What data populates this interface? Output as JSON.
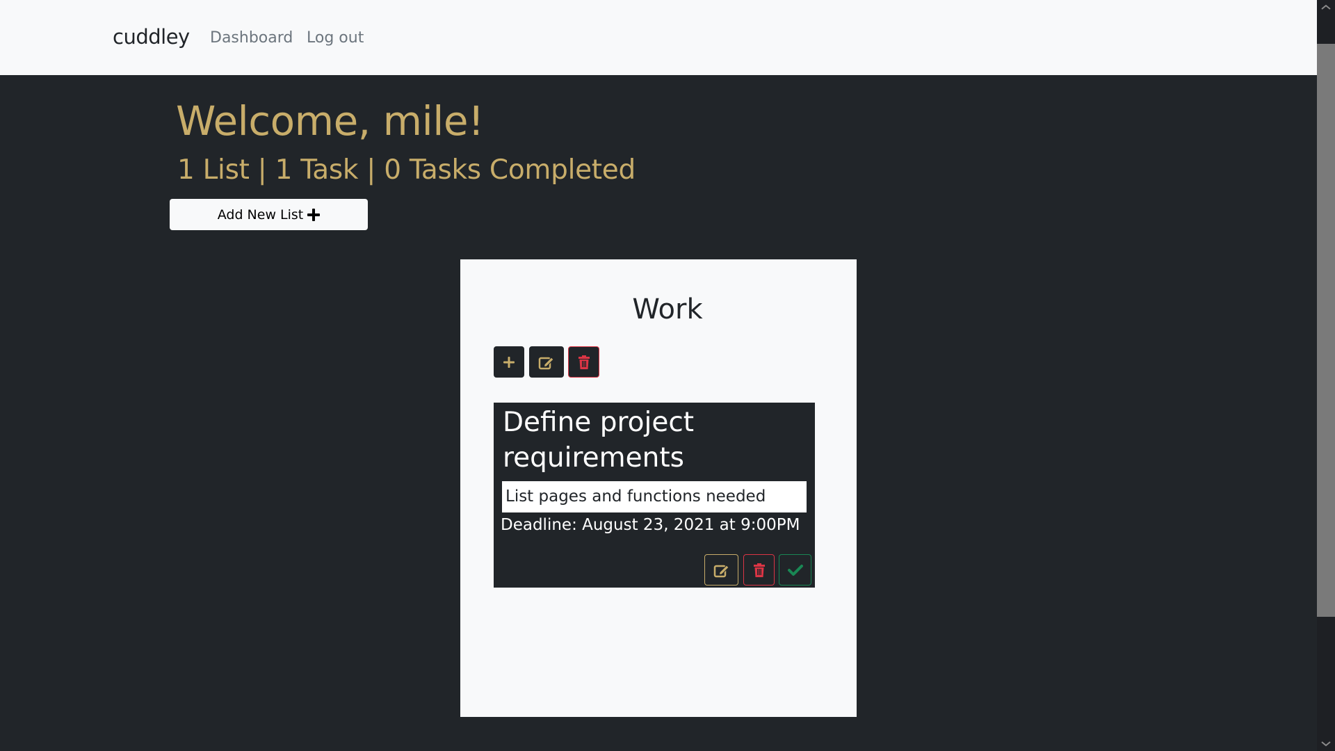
{
  "navbar": {
    "brand": "cuddley",
    "links": [
      {
        "label": "Dashboard"
      },
      {
        "label": "Log out"
      }
    ]
  },
  "header": {
    "welcome": "Welcome, mile!",
    "stats": "1 List | 1 Task | 0 Tasks Completed",
    "add_list_label": "Add New List",
    "add_list_icon": "plus-icon"
  },
  "lists": [
    {
      "title": "Work",
      "actions": [
        {
          "name": "add-task",
          "icon": "plus-icon"
        },
        {
          "name": "edit-list",
          "icon": "edit-icon"
        },
        {
          "name": "delete-list",
          "icon": "trash-icon"
        }
      ],
      "tasks": [
        {
          "title": "Define project requirements",
          "description": "List pages and functions needed",
          "deadline": "Deadline: August 23, 2021 at 9:00PM",
          "actions": [
            {
              "name": "edit-task",
              "icon": "edit-icon"
            },
            {
              "name": "delete-task",
              "icon": "trash-icon"
            },
            {
              "name": "complete-task",
              "icon": "check-icon"
            }
          ]
        }
      ]
    }
  ],
  "colors": {
    "accent": "#c8ad6a",
    "danger": "#dc3545",
    "success": "#198754",
    "dark": "#212529",
    "light": "#f8f9fa",
    "muted": "#6c757d"
  }
}
